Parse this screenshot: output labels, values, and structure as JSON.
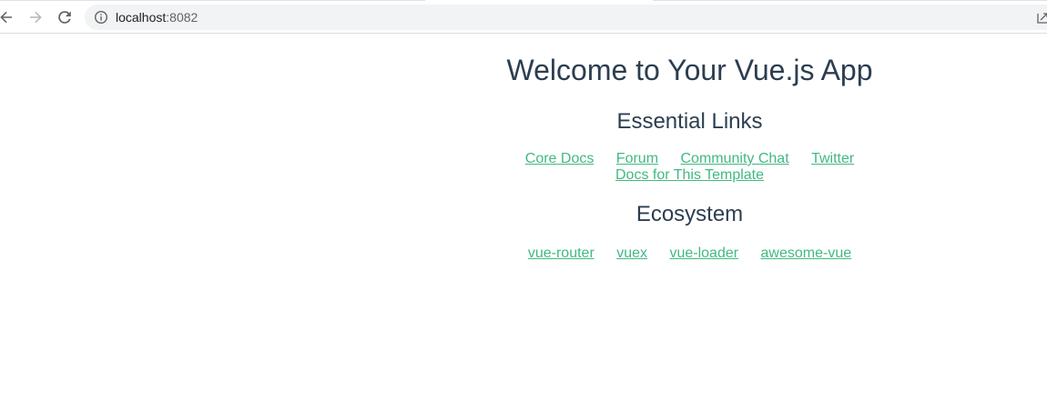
{
  "browser": {
    "url_host": "localhost",
    "url_port": ":8082",
    "icons": {
      "back": "arrow-left-icon",
      "forward": "arrow-right-icon",
      "reload": "reload-icon",
      "site_info": "info-icon",
      "share": "share-icon"
    }
  },
  "app": {
    "title": "Welcome to Your Vue.js App",
    "essential_heading": "Essential Links",
    "essential_links": [
      "Core Docs",
      "Forum",
      "Community Chat",
      "Twitter",
      "Docs for This Template"
    ],
    "ecosystem_heading": "Ecosystem",
    "ecosystem_links": [
      "vue-router",
      "vuex",
      "vue-loader",
      "awesome-vue"
    ]
  },
  "colors": {
    "heading_text": "#2c3e50",
    "link": "#42b983",
    "omnibox_bg": "#f1f3f4"
  }
}
